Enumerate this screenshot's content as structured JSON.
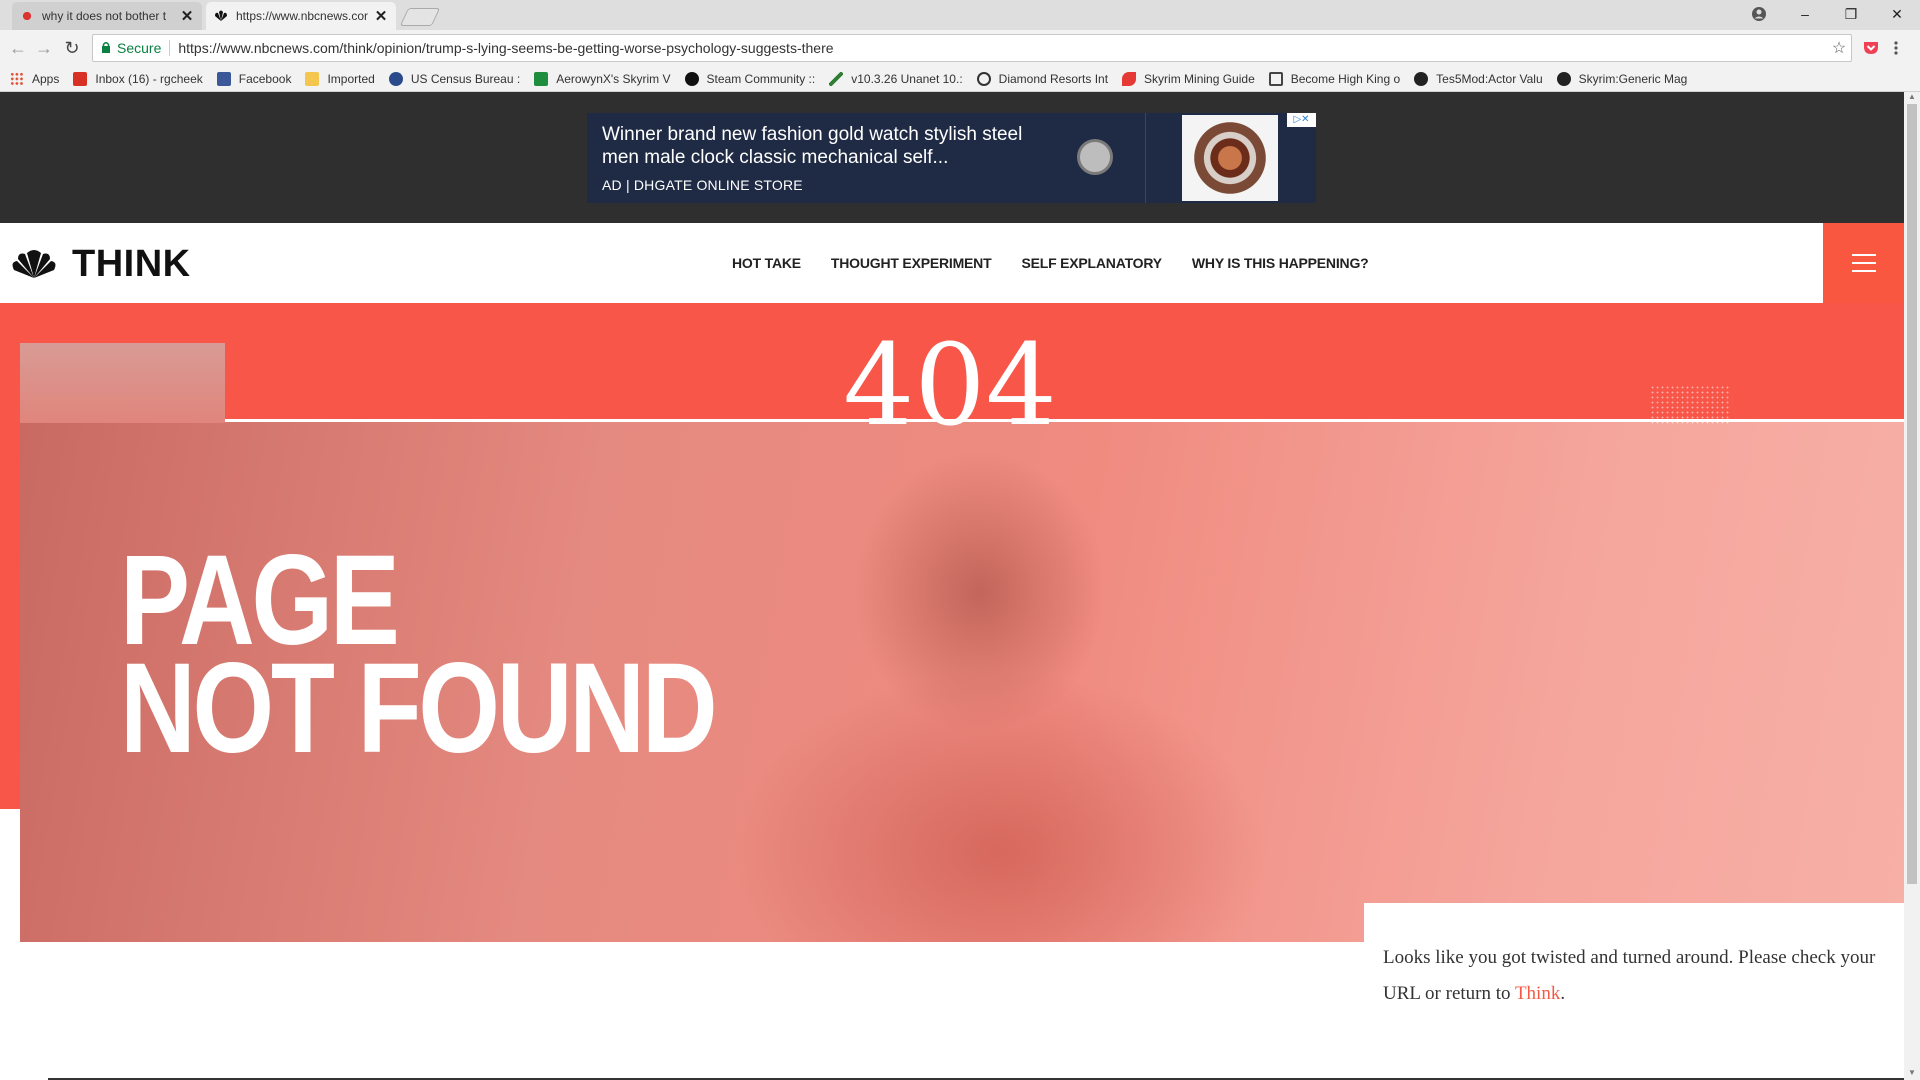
{
  "browser": {
    "tabs": [
      {
        "title": "why it does not bother t",
        "close": "✕"
      },
      {
        "title": "https://www.nbcnews.cor",
        "close": "✕"
      }
    ],
    "window_controls": {
      "minimize": "–",
      "restore": "❐",
      "close": "✕"
    },
    "omnibox": {
      "secure_label": "Secure",
      "url": "https://www.nbcnews.com/think/opinion/trump-s-lying-seems-be-getting-worse-psychology-suggests-there"
    },
    "bookmarks": [
      {
        "label": "Apps",
        "icon_color": "#e0533b"
      },
      {
        "label": "Inbox (16) - rgcheek",
        "icon_color": "#d93025"
      },
      {
        "label": "Facebook",
        "icon_color": "#3b5998"
      },
      {
        "label": "Imported",
        "icon_color": "#f4c64d"
      },
      {
        "label": "US Census Bureau :",
        "icon_color": "#2b4a8b"
      },
      {
        "label": "AerowynX's Skyrim V",
        "icon_color": "#1e8e3e"
      },
      {
        "label": "Steam Community ::",
        "icon_color": "#111111"
      },
      {
        "label": "v10.3.26 Unanet 10.:",
        "icon_color": "#2e7d32"
      },
      {
        "label": "Diamond Resorts Int",
        "icon_color": "#333333"
      },
      {
        "label": "Skyrim Mining Guide",
        "icon_color": "#e53935"
      },
      {
        "label": "Become High King o",
        "icon_color": "#444444"
      },
      {
        "label": "Tes5Mod:Actor Valu",
        "icon_color": "#222222"
      },
      {
        "label": "Skyrim:Generic Mag",
        "icon_color": "#222222"
      }
    ]
  },
  "ad": {
    "headline": "Winner brand new fashion gold watch stylish steel men male clock classic mechanical self...",
    "source": "AD | DHGATE ONLINE STORE",
    "adchoices": "▷✕"
  },
  "site": {
    "logo_text": "THINK",
    "nav": [
      "HOT TAKE",
      "THOUGHT EXPERIMENT",
      "SELF EXPLANATORY",
      "WHY IS THIS HAPPENING?"
    ],
    "brand_color": "#f9564a"
  },
  "error": {
    "code": "404",
    "title_line1": "PAGE",
    "title_line2": "NOT FOUND",
    "message_prefix": "Looks like you got twisted and turned around. Please check your URL or return to ",
    "link_text": "Think",
    "message_suffix": "."
  }
}
